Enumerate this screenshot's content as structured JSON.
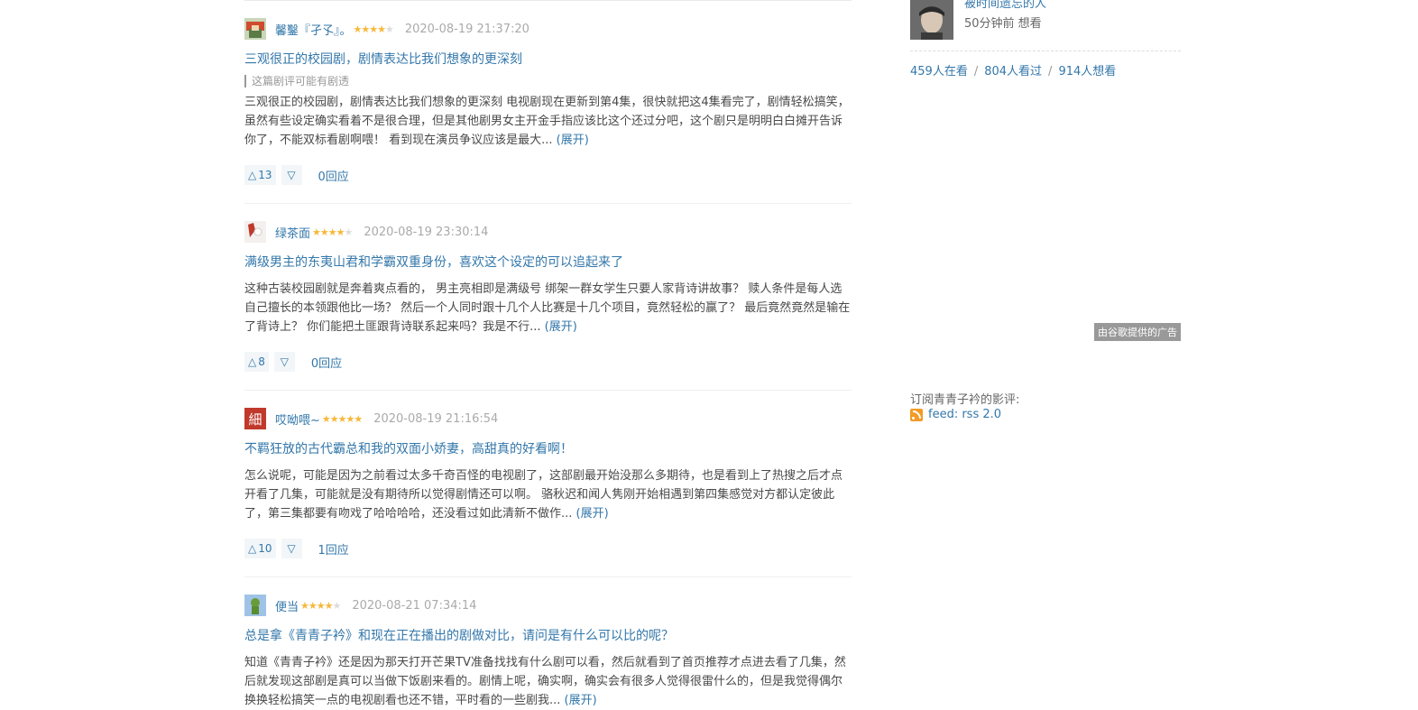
{
  "reviews": [
    {
      "user": "馨鑿『孑孓』。",
      "rating": 4,
      "time": "2020-08-19 21:37:20",
      "title": "三观很正的校园剧，剧情表达比我们想象的更深刻",
      "spoiler": "这篇剧评可能有剧透",
      "body": "三观很正的校园剧，剧情表达比我们想象的更深刻 电视剧现在更新到第4集，很快就把这4集看完了，剧情轻松搞笑，虽然有些设定确实看着不是很合理，但是其他剧男女主开金手指应该比这个还过分吧，这个剧只是明明白白摊开告诉你了，不能双标看剧啊喂！ 看到现在演员争议应该是最大...",
      "expand": "(展开)",
      "up": "13",
      "replies": "0回应"
    },
    {
      "user": "绿茶面",
      "rating": 4,
      "time": "2020-08-19 23:30:14",
      "title": "满级男主的东夷山君和学霸双重身份，喜欢这个设定的可以追起来了",
      "body": "这种古装校园剧就是奔着爽点看的， 男主亮相即是满级号 绑架一群女学生只要人家背诗讲故事？ 赎人条件是每人选自己擅长的本领跟他比一场？ 然后一个人同时跟十几个人比赛是十几个项目，竟然轻松的赢了？ 最后竟然竟然是输在了背诗上？ 你们能把土匪跟背诗联系起来吗？我是不行...",
      "expand": "(展开)",
      "up": "8",
      "replies": "0回应"
    },
    {
      "user": "哎呦喂~",
      "rating": 5,
      "time": "2020-08-19 21:16:54",
      "title": "不羁狂放的古代霸总和我的双面小娇妻，高甜真的好看啊！",
      "body": "怎么说呢，可能是因为之前看过太多千奇百怪的电视剧了，这部剧最开始没那么多期待，也是看到上了热搜之后才点开看了几集，可能就是没有期待所以觉得剧情还可以啊。 骆秋迟和闻人隽刚开始相遇到第四集感觉对方都认定彼此了，第三集都要有吻戏了哈哈哈哈，还没看过如此清新不做作...",
      "expand": "(展开)",
      "up": "10",
      "replies": "1回应"
    },
    {
      "user": "便当",
      "rating": 4,
      "time": "2020-08-21 07:34:14",
      "title": "总是拿《青青子衿》和现在正在播出的剧做对比，请问是有什么可以比的呢？",
      "body": "知道《青青子衿》还是因为那天打开芒果TV准备找找有什么剧可以看，然后就看到了首页推荐才点进去看了几集，然后就发现这部剧是真可以当做下饭剧来看的。剧情上呢，确实啊，确实会有很多人觉得很雷什么的，但是我觉得偶尔换换轻松搞笑一点的电视剧看也还不错，平时看的一些剧我...",
      "expand": "(展开)"
    }
  ],
  "sidebar": {
    "wisher_name": "被时间遗忘的人",
    "wisher_status": "50分钟前 想看",
    "stats": [
      "459人在看",
      "804人看过",
      "914人想看"
    ],
    "ad_label": "由谷歌提供的广告",
    "subscribe_label": "订阅青青子衿的影评:",
    "feed_label": "feed: rss 2.0"
  },
  "colors": {
    "link": "#3377aa",
    "star": "#f7b83a",
    "rss": "#f39b26"
  }
}
